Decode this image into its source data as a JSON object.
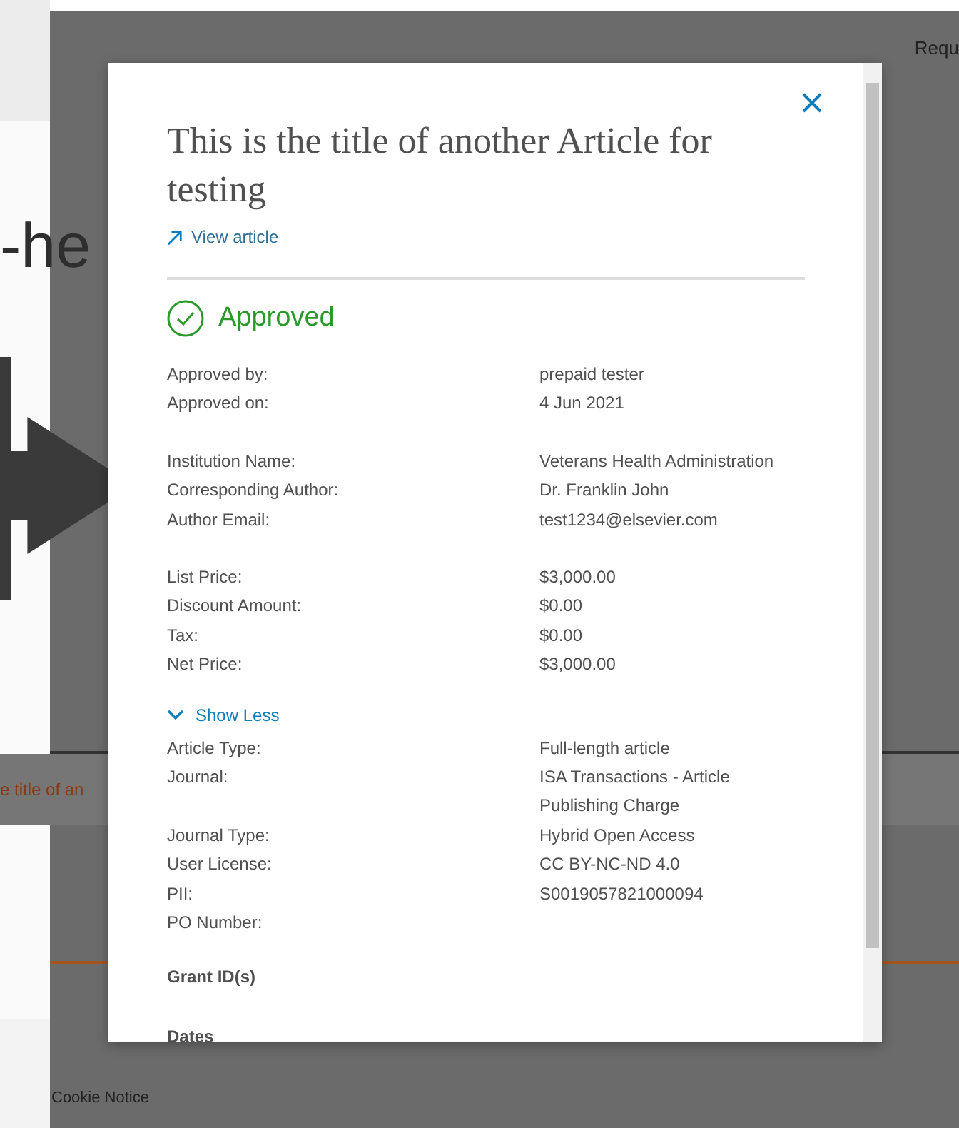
{
  "background": {
    "header_link": "Requ",
    "heading_fragment": "-he",
    "row_title_fragment": "e title of an",
    "footer_link": "Cookie Notice"
  },
  "modal": {
    "title": "This is the title of another Article for testing",
    "view_article": "View article",
    "status": {
      "kind": "approved",
      "label": "Approved"
    },
    "summary_groups": [
      {
        "rows": [
          {
            "label": "Approved by:",
            "value": "prepaid tester"
          },
          {
            "label": "Approved on:",
            "value": "4 Jun 2021"
          }
        ]
      },
      {
        "rows": [
          {
            "label": "Institution Name:",
            "value": "Veterans Health Administration"
          },
          {
            "label": "Corresponding Author:",
            "value": "Dr. Franklin John"
          },
          {
            "label": "Author Email:",
            "value": "test1234@elsevier.com"
          }
        ]
      },
      {
        "rows": [
          {
            "label": "List Price:",
            "value": "$3,000.00"
          },
          {
            "label": "Discount Amount:",
            "value": "$0.00"
          },
          {
            "label": "Tax:",
            "value": "$0.00"
          },
          {
            "label": "Net Price:",
            "value": "$3,000.00"
          }
        ]
      }
    ],
    "toggle": {
      "label": "Show Less",
      "expanded": true
    },
    "details": [
      {
        "label": "Article Type:",
        "value": "Full-length article"
      },
      {
        "label": "Journal:",
        "value": "ISA Transactions - Article Publishing Charge"
      },
      {
        "label": "Journal Type:",
        "value": "Hybrid Open Access"
      },
      {
        "label": "User License:",
        "value": "CC BY-NC-ND 4.0"
      },
      {
        "label": "PII:",
        "value": "S0019057821000094"
      },
      {
        "label": "PO Number:"
      }
    ],
    "sections": [
      {
        "heading": "Grant ID(s)"
      },
      {
        "heading": "Dates"
      }
    ]
  }
}
